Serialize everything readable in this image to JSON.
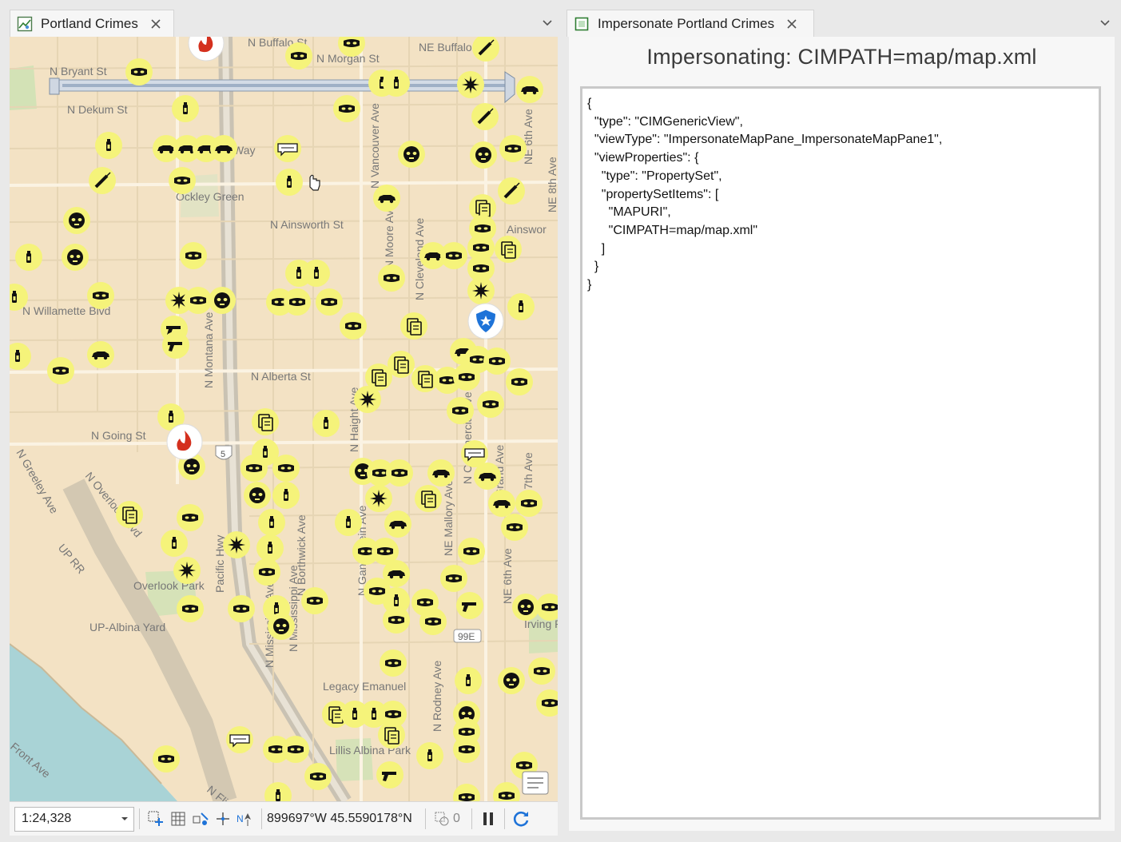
{
  "left_tab": {
    "title": "Portland Crimes"
  },
  "right_tab": {
    "title": "Impersonate Portland Crimes"
  },
  "map": {
    "street_labels": [
      "N Buffalo St",
      "NE Buffalo",
      "N Morgan St",
      "N Bryant St",
      "N Dekum St",
      "Way",
      "N Ainsworth St",
      "Ainswor",
      "N Willamette Blvd",
      "N Alberta St",
      "N Going St",
      "N Greeley Ave",
      "N Overlook Blvd",
      "UP RR",
      "Overlook Park",
      "UP-Albina Yard",
      "Pacific Hwy",
      "N Montana Ave",
      "N Borthwick Ave",
      "N Vancouver Ave",
      "N Moore Ave",
      "N Cleveland Ave",
      "N Haight Ave",
      "N Mississippi Ave",
      "NE Mallory Ave",
      "NE 6th Ave",
      "NE 8th Ave",
      "NE 7th Ave",
      "NE 6th Ave",
      "Irving Park",
      "Ockley Green",
      "Legacy Emanuel",
      "Lillis Albina Park",
      "N Rodney Ave",
      "N Commercial Ave",
      "Front Ave",
      "N Flint Ave",
      "N Mississippi Ave",
      "5",
      "99E",
      "N Gantenbein Ave",
      "NE Grand Ave"
    ],
    "scale": "1:24,328",
    "coordinates": "899697°W 45.5590178°N",
    "selection_count": "0"
  },
  "impersonate": {
    "heading": "Impersonating:  CIMPATH=map/map.xml",
    "json_text": "{\n  \"type\": \"CIMGenericView\",\n  \"viewType\": \"ImpersonateMapPane_ImpersonateMapPane1\",\n  \"viewProperties\": {\n    \"type\": \"PropertySet\",\n    \"propertySetItems\": [\n      \"MAPURI\",\n      \"CIMPATH=map/map.xml\"\n    ]\n  }\n}"
  },
  "icons": [
    "map-tab-icon",
    "close-icon",
    "chevron-down-icon",
    "view-tab-icon",
    "add-graphic-icon",
    "grid-icon",
    "snapping-icon",
    "crosshair-icon",
    "north-arrow-icon",
    "selection-icon",
    "pause-icon",
    "refresh-icon",
    "theft-mask-icon",
    "spray-can-icon",
    "car-icon",
    "burst-icon",
    "gun-icon",
    "drug-syringe-icon",
    "fire-station-icon",
    "police-station-icon",
    "cursor-hand-icon"
  ],
  "colors": {
    "symbol_fill": "#f5f37a",
    "fire": "#d4301e",
    "police": "#1e73d8",
    "map_background": "#f3e2c4",
    "water": "#a9d3d6",
    "park": "#d3e2b6",
    "rail": "#bfbfbf"
  }
}
